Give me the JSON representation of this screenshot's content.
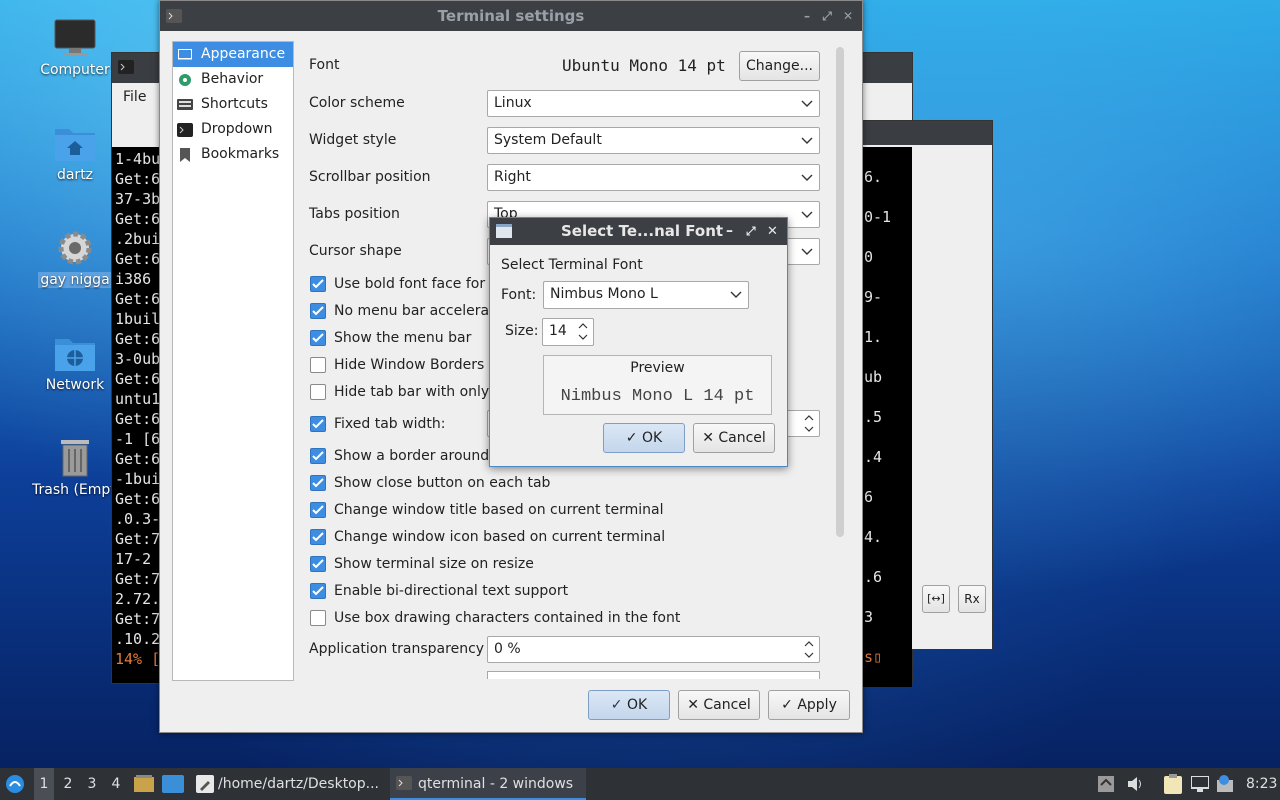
{
  "desktop": {
    "icons": [
      {
        "label": "Computer",
        "icon": "computer-icon"
      },
      {
        "label": "dartz",
        "icon": "home-folder-icon"
      },
      {
        "label": "gay nigga",
        "icon": "gear-icon"
      },
      {
        "label": "Network",
        "icon": "network-folder-icon"
      },
      {
        "label": "Trash (Empty)",
        "icon": "trash-icon"
      }
    ]
  },
  "bg_terminal": {
    "menu_file": "File",
    "lines": [
      "1-4bu",
      "Get:6",
      "37-3b",
      "Get:6",
      ".2bui",
      "Get:6",
      "i386 ",
      "Get:6",
      "1buil",
      "Get:6",
      "3-0ub",
      "Get:6",
      "untu1",
      "Get:6",
      "-1 [6",
      "Get:6",
      "-1bui",
      "Get:6",
      ".0.3-",
      "Get:7",
      "17-2 ",
      "Get:7",
      "2.72.",
      "Get:7",
      ".10.2"
    ],
    "progress_line": "14% [",
    "right_lines": [
      "6.",
      "0-1",
      "0",
      "9-",
      "1.",
      "ub",
      ".5",
      ".4",
      "6",
      "4.",
      ".6",
      "3"
    ],
    "right_cursor": "s"
  },
  "settings": {
    "title": "Terminal settings",
    "sidebar": [
      {
        "label": "Appearance",
        "icon": "appearance-icon"
      },
      {
        "label": "Behavior",
        "icon": "behavior-icon"
      },
      {
        "label": "Shortcuts",
        "icon": "keyboard-icon"
      },
      {
        "label": "Dropdown",
        "icon": "dropdown-terminal-icon"
      },
      {
        "label": "Bookmarks",
        "icon": "bookmark-icon"
      }
    ],
    "font_label": "Font",
    "font_value": "Ubuntu Mono 14 pt",
    "change_button": "Change...",
    "color_scheme_label": "Color scheme",
    "color_scheme_value": "Linux",
    "widget_style_label": "Widget style",
    "widget_style_value": "System Default",
    "scrollbar_label": "Scrollbar position",
    "scrollbar_value": "Right",
    "tabs_label": "Tabs position",
    "tabs_value": "Top",
    "cursor_label": "Cursor shape",
    "cursor_value": "",
    "checkboxes": [
      {
        "label": "Use bold font face for i",
        "checked": true
      },
      {
        "label": "No menu bar accelerato",
        "checked": true
      },
      {
        "label": "Show the menu bar",
        "checked": true
      },
      {
        "label": "Hide Window Borders",
        "checked": false
      },
      {
        "label": "Hide tab bar with only o",
        "checked": false
      },
      {
        "label": "Fixed tab width:",
        "checked": true
      },
      {
        "label": "Show a border around t",
        "checked": true
      },
      {
        "label": "Show close button on each tab",
        "checked": true
      },
      {
        "label": "Change window title based on current terminal",
        "checked": true
      },
      {
        "label": "Change window icon based on current terminal",
        "checked": true
      },
      {
        "label": "Show terminal size on resize",
        "checked": true
      },
      {
        "label": "Enable bi-directional text support",
        "checked": true
      },
      {
        "label": "Use box drawing characters contained in the font",
        "checked": false
      }
    ],
    "transparency_label": "Application transparency",
    "transparency_value": "0 %",
    "ok_button": "OK",
    "cancel_button": "Cancel",
    "apply_button": "Apply"
  },
  "font_dialog": {
    "title": "Select Te...nal Font",
    "heading": "Select Terminal Font",
    "font_label": "Font:",
    "font_value": "Nimbus Mono L",
    "size_label": "Size:",
    "size_value": "14",
    "preview_label": "Preview",
    "preview_text": "Nimbus Mono L 14 pt",
    "ok_button": "OK",
    "cancel_button": "Cancel"
  },
  "taskbar": {
    "workspaces": [
      "1",
      "2",
      "3",
      "4"
    ],
    "tasks": [
      {
        "label": "/home/dartz/Desktop...",
        "icon": "text-editor-icon"
      },
      {
        "label": "qterminal - 2 windows",
        "icon": "terminal-icon"
      }
    ],
    "clock": "8:23"
  }
}
